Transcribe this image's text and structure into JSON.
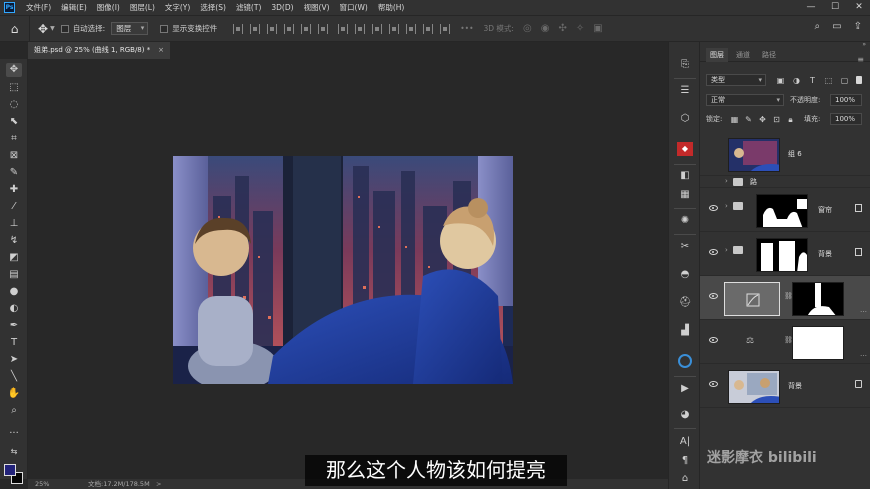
{
  "app": {
    "logo_text": "Ps"
  },
  "menubar": {
    "items": [
      "文件(F)",
      "编辑(E)",
      "图像(I)",
      "图层(L)",
      "文字(Y)",
      "选择(S)",
      "滤镜(T)",
      "3D(D)",
      "视图(V)",
      "窗口(W)",
      "帮助(H)"
    ]
  },
  "options": {
    "auto_select_label": "自动选择:",
    "auto_select_value": "图层",
    "transform_label": "显示变换控件",
    "mode3d_label": "3D 模式:"
  },
  "document": {
    "tab_title": "姐弟.psd @ 25% (曲线 1, RGB/8) *",
    "close": "×"
  },
  "status": {
    "zoom": "25%",
    "doc_size": "文档:17.2M/178.5M",
    "arrow": ">"
  },
  "layers_panel": {
    "tabs": [
      "图层",
      "通道",
      "路径"
    ],
    "kind_label": "类型",
    "blend_mode": "正常",
    "opacity_label": "不透明度:",
    "opacity_value": "100%",
    "lock_label": "锁定:",
    "fill_label": "填充:",
    "fill_value": "100%",
    "layers": [
      {
        "name": "组 6"
      },
      {
        "name": "路"
      },
      {
        "name": "窗帘"
      },
      {
        "name": "背景"
      },
      {
        "name": ""
      },
      {
        "name": ""
      },
      {
        "name": "背景"
      }
    ]
  },
  "subtitle": "那么这个人物该如何提亮",
  "watermark": "迷影摩衣 bilibili",
  "colors": {
    "accent": "#31a8ff",
    "foreground": "#23237a",
    "background": "#050505"
  }
}
